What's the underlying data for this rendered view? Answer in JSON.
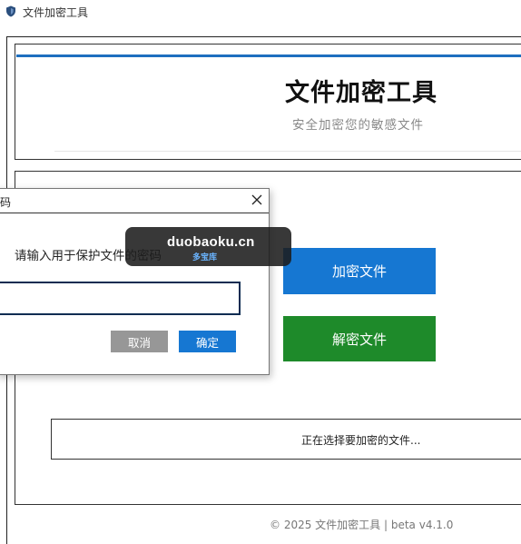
{
  "window": {
    "title": "文件加密工具"
  },
  "header": {
    "title": "文件加密工具",
    "subtitle": "安全加密您的敏感文件"
  },
  "actions": {
    "encrypt_label": "加密文件",
    "decrypt_label": "解密文件"
  },
  "status": {
    "text": "正在选择要加密的文件..."
  },
  "footer": {
    "text": "© 2025 文件加密工具 | beta v4.1.0"
  },
  "dialog": {
    "title": "码",
    "prompt": "请输入用于保护文件的密码",
    "input_value": "",
    "cancel_label": "取消",
    "ok_label": "确定",
    "close_glyph": "✕"
  },
  "watermark": {
    "main": "duobaoku.cn",
    "sub": "多宝库"
  },
  "colors": {
    "accent_blue": "#1677d2",
    "decrypt_green": "#1e8a2a",
    "cancel_gray": "#979797",
    "header_accent": "#1e6fbf"
  }
}
